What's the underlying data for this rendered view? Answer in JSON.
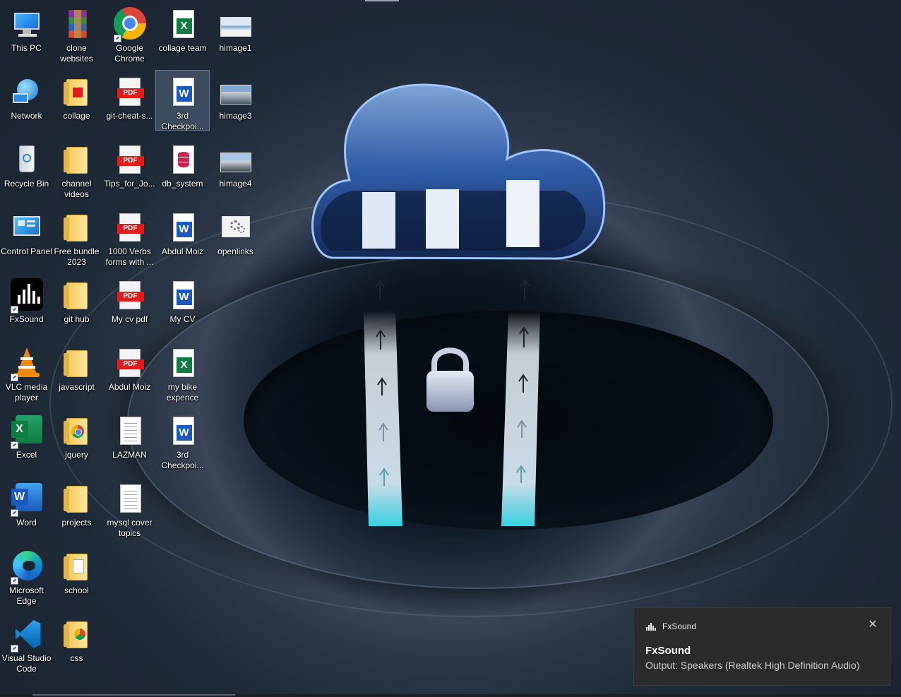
{
  "desktop": {
    "icons": [
      {
        "label": "This PC"
      },
      {
        "label": "clone websites"
      },
      {
        "label": "Google Chrome"
      },
      {
        "label": "collage team"
      },
      {
        "label": "himage1"
      },
      {
        "label": "Network"
      },
      {
        "label": "collage"
      },
      {
        "label": "git-cheat-s..."
      },
      {
        "label": "3rd Checkpoi..."
      },
      {
        "label": "himage3"
      },
      {
        "label": "Recycle Bin"
      },
      {
        "label": "channel videos"
      },
      {
        "label": "Tips_for_Jo..."
      },
      {
        "label": "db_system"
      },
      {
        "label": "himage4"
      },
      {
        "label": "Control Panel"
      },
      {
        "label": "Free bundle 2023"
      },
      {
        "label": "1000 Verbs forms with ..."
      },
      {
        "label": "Abdul Moiz"
      },
      {
        "label": "openlinks"
      },
      {
        "label": "FxSound"
      },
      {
        "label": "git hub"
      },
      {
        "label": "My cv pdf"
      },
      {
        "label": "My CV"
      },
      {
        "label": "VLC media player"
      },
      {
        "label": "javascript"
      },
      {
        "label": "Abdul Moiz"
      },
      {
        "label": "my bike expence"
      },
      {
        "label": "Excel"
      },
      {
        "label": "jquery"
      },
      {
        "label": "LAZMAN"
      },
      {
        "label": "3rd Checkpoi..."
      },
      {
        "label": "Word"
      },
      {
        "label": "projects"
      },
      {
        "label": "mysql cover topics"
      },
      {
        "label": "Microsoft Edge"
      },
      {
        "label": "school"
      },
      {
        "label": "Visual Studio Code"
      },
      {
        "label": "css"
      }
    ]
  },
  "notification": {
    "app_name": "FxSound",
    "close_glyph": "✕",
    "title": "FxSound",
    "body": "Output: Speakers (Realtek High Definition Audio)"
  },
  "colors": {
    "pdf_red": "#e21b1b",
    "word_blue": "#185abd",
    "excel_green": "#107c41",
    "folder_yellow": "#f3c95b",
    "notification_bg": "#2b2b2b"
  }
}
